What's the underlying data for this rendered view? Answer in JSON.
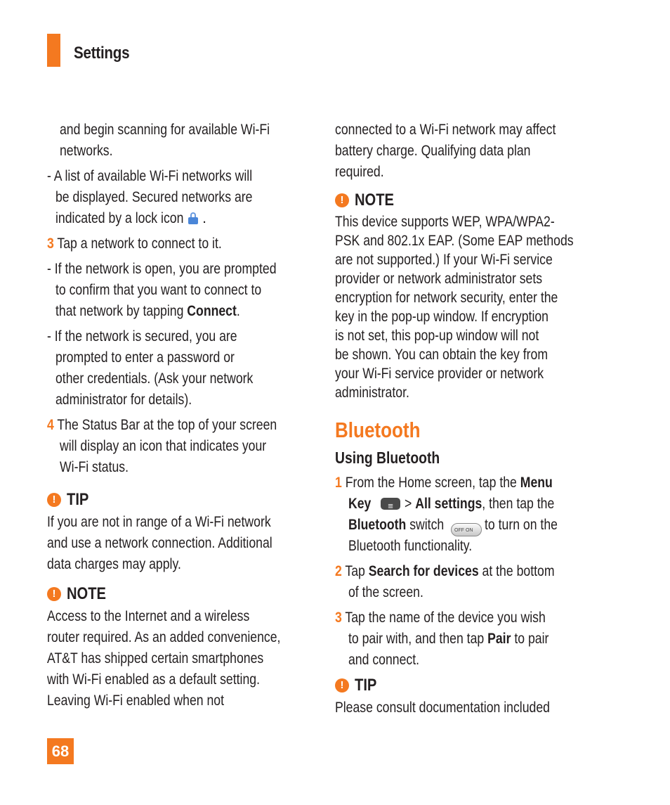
{
  "header": {
    "title": "Settings"
  },
  "left": {
    "cont_lines": [
      "and begin scanning for available Wi-Fi",
      "networks."
    ],
    "bullet1": [
      "- A list of available Wi-Fi networks will",
      "be displayed. Secured networks are",
      "indicated by a lock icon",
      "."
    ],
    "step3": {
      "num": "3",
      "text": "Tap a network to connect to it."
    },
    "bullet2": [
      "- If the network is open, you are prompted",
      "to confirm that you want to connect to",
      "that network by tapping ",
      "Connect",
      "."
    ],
    "bullet3": [
      "- If the network is secured, you are",
      "prompted to enter a password or",
      "other credentials. (Ask your network",
      "administrator for details)."
    ],
    "step4": {
      "num": "4",
      "lines": [
        "The Status Bar at the top of your screen",
        "will display an icon that  indicates your",
        "Wi-Fi status."
      ]
    },
    "tip": {
      "icon": "!",
      "label": "TIP",
      "lines": [
        "If you are not in range of a Wi-Fi network",
        "and use a network connection. Additional",
        "data charges may apply."
      ]
    },
    "note": {
      "icon": "!",
      "label": "NOTE",
      "lines": [
        "Access to the Internet and a wireless",
        "router required. As an added convenience,",
        "AT&T has shipped certain smartphones",
        "with Wi-Fi enabled as a default setting.",
        "Leaving Wi-Fi enabled when not"
      ]
    }
  },
  "right": {
    "cont_lines": [
      "connected to a Wi-Fi network may affect",
      "battery charge. Qualifying data plan",
      "required."
    ],
    "note": {
      "icon": "!",
      "label": "NOTE",
      "lines": [
        "This device supports WEP, WPA/WPA2-",
        "PSK and 802.1x EAP. (Some EAP methods",
        "are not supported.) If your Wi-Fi service",
        "provider or network administrator sets",
        "encryption for network security, enter the",
        "key in the pop-up window. If encryption",
        "is not set, this pop-up window will not",
        "be shown. You can obtain the key from",
        "your Wi-Fi service provider or network",
        "administrator."
      ]
    },
    "section_title": "Bluetooth",
    "subsection_title": "Using Bluetooth",
    "step1": {
      "num": "1",
      "l1a": "From the Home screen, tap the ",
      "l1b": "Menu",
      "l2a": "Key",
      "l2b": " > ",
      "l2c": "All settings",
      "l2d": ", then tap the",
      "l3a": "Bluetooth",
      "l3b": " switch",
      "switch_label": "OFF  ON",
      "l3c": " to turn on the",
      "l4": "Bluetooth functionality."
    },
    "step2": {
      "num": "2",
      "l1a": "Tap ",
      "l1b": "Search for devices",
      "l1c": " at the bottom",
      "l2": "of the screen."
    },
    "step3": {
      "num": "3",
      "l1": "Tap the name of the device you wish",
      "l2a": "to pair with, and then tap ",
      "l2b": "Pair",
      "l2c": " to pair",
      "l3": "and connect."
    },
    "tip": {
      "icon": "!",
      "label": "TIP",
      "lines": [
        "Please consult documentation included"
      ]
    }
  },
  "footer": {
    "page_number": "68"
  }
}
